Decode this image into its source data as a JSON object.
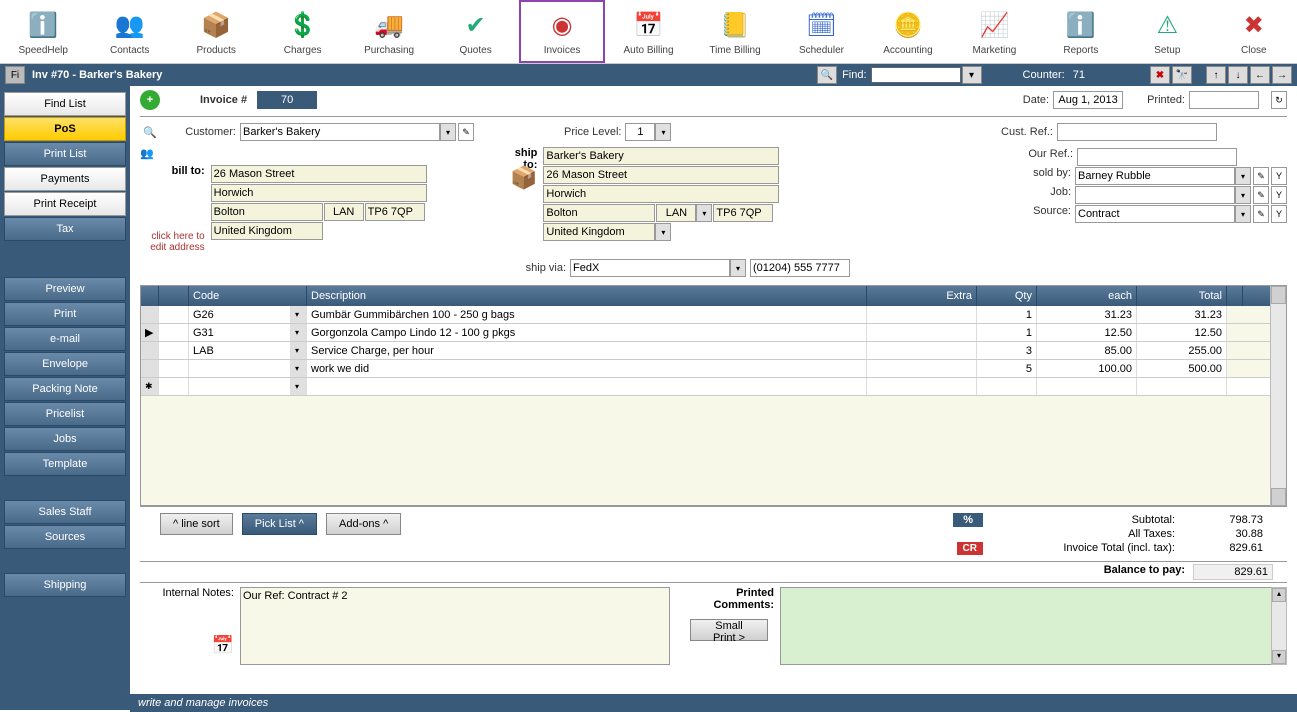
{
  "toolbar": [
    {
      "label": "SpeedHelp",
      "icon": "ℹ️",
      "color": "#2e86de"
    },
    {
      "label": "Contacts",
      "icon": "👥",
      "color": "#666"
    },
    {
      "label": "Products",
      "icon": "📦",
      "color": "#8b4513"
    },
    {
      "label": "Charges",
      "icon": "💲",
      "color": "#2a7"
    },
    {
      "label": "Purchasing",
      "icon": "🚚",
      "color": "#d4a"
    },
    {
      "label": "Quotes",
      "icon": "✔",
      "color": "#2a7"
    },
    {
      "label": "Invoices",
      "icon": "◉",
      "color": "#c33",
      "active": true
    },
    {
      "label": "Auto Billing",
      "icon": "📅",
      "color": "#36c"
    },
    {
      "label": "Time Billing",
      "icon": "📒",
      "color": "#36c"
    },
    {
      "label": "Scheduler",
      "icon": "🗓",
      "color": "#36c"
    },
    {
      "label": "Accounting",
      "icon": "🪙",
      "color": "#d4a017"
    },
    {
      "label": "Marketing",
      "icon": "📈",
      "color": "#36c"
    },
    {
      "label": "Reports",
      "icon": "ℹ️",
      "color": "#888"
    },
    {
      "label": "Setup",
      "icon": "⚠",
      "color": "#2a7"
    },
    {
      "label": "Close",
      "icon": "✖",
      "color": "#c33"
    }
  ],
  "subheader": {
    "title": "Inv #70 - Barker's Bakery",
    "find_label": "Find:",
    "counter_label": "Counter:",
    "counter_value": "71"
  },
  "sidebar": {
    "g1": [
      {
        "label": "Find List",
        "style": "white"
      },
      {
        "label": "PoS",
        "style": "yellow"
      },
      {
        "label": "Print List",
        "style": "blue"
      },
      {
        "label": "Payments",
        "style": "white"
      },
      {
        "label": "Print Receipt",
        "style": "white"
      },
      {
        "label": "Tax",
        "style": "blue"
      }
    ],
    "g2": [
      {
        "label": "Preview"
      },
      {
        "label": "Print"
      },
      {
        "label": "e-mail"
      },
      {
        "label": "Envelope"
      },
      {
        "label": "Packing Note"
      },
      {
        "label": "Pricelist"
      },
      {
        "label": "Jobs"
      },
      {
        "label": "Template"
      }
    ],
    "g3": [
      {
        "label": "Sales Staff"
      },
      {
        "label": "Sources"
      }
    ],
    "g4": [
      {
        "label": "Shipping"
      }
    ]
  },
  "header": {
    "invoice_label": "Invoice #",
    "invoice_no": "70",
    "date_label": "Date:",
    "date_value": "Aug 1, 2013",
    "printed_label": "Printed:",
    "printed_value": "",
    "customer_label": "Customer:",
    "customer_value": "Barker's Bakery",
    "price_level_label": "Price Level:",
    "price_level_value": "1",
    "cust_ref_label": "Cust. Ref.:",
    "cust_ref_value": "",
    "bill_to_label": "bill to:",
    "ship_to_label": "ship to:",
    "click_hint": "click here to edit address",
    "our_ref_label": "Our Ref.:",
    "our_ref_value": "",
    "sold_by_label": "sold by:",
    "sold_by_value": "Barney Rubble",
    "job_label": "Job:",
    "job_value": "",
    "source_label": "Source:",
    "source_value": "Contract",
    "ship_via_label": "ship via:",
    "ship_via_value": "FedX",
    "ship_phone": "(01204) 555 7777",
    "bill_addr": {
      "street": "26 Mason Street",
      "city": "Horwich",
      "town": "Bolton",
      "region": "LAN",
      "postcode": "TP6 7QP",
      "country": "United Kingdom"
    },
    "ship_addr": {
      "name": "Barker's Bakery",
      "street": "26 Mason Street",
      "city": "Horwich",
      "town": "Bolton",
      "region": "LAN",
      "postcode": "TP6 7QP",
      "country": "United Kingdom"
    }
  },
  "grid": {
    "columns": [
      "",
      "",
      "Code",
      "Description",
      "Extra",
      "Qty",
      "each",
      "Total"
    ],
    "rows": [
      {
        "code": "G26",
        "desc": "Gumbär Gummibärchen 100 - 250 g bags",
        "extra": "",
        "qty": "1",
        "each": "31.23",
        "total": "31.23"
      },
      {
        "code": "G31",
        "desc": "Gorgonzola Campo Lindo 12 - 100 g pkgs",
        "extra": "",
        "qty": "1",
        "each": "12.50",
        "total": "12.50",
        "current": true
      },
      {
        "code": "LAB",
        "desc": "Service Charge, per hour",
        "extra": "",
        "qty": "3",
        "each": "85.00",
        "total": "255.00"
      },
      {
        "code": "",
        "desc": "work we did",
        "extra": "",
        "qty": "5",
        "each": "100.00",
        "total": "500.00"
      }
    ]
  },
  "actions": {
    "line_sort": "^ line sort",
    "pick_list": "Pick List ^",
    "addons": "Add-ons ^",
    "pct": "%",
    "cr": "CR"
  },
  "totals": {
    "subtotal_label": "Subtotal:",
    "subtotal": "798.73",
    "taxes_label": "All Taxes:",
    "taxes": "30.88",
    "invoice_total_label": "Invoice Total (incl. tax):",
    "invoice_total": "829.61",
    "balance_label": "Balance to pay:",
    "balance": "829.61"
  },
  "notes": {
    "internal_label": "Internal Notes:",
    "internal_value": "Our Ref: Contract # 2",
    "printed_label": "Printed Comments:",
    "small_print": "Small Print >"
  },
  "statusbar": "write and manage invoices"
}
